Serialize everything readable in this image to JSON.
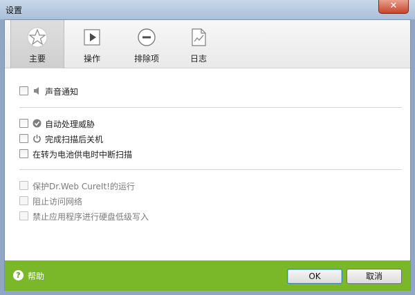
{
  "window": {
    "title": "设置",
    "close_glyph": "✕"
  },
  "toolbar": {
    "tabs": [
      {
        "label": "主要",
        "icon": "star-icon",
        "active": true
      },
      {
        "label": "操作",
        "icon": "play-icon",
        "active": false
      },
      {
        "label": "排除项",
        "icon": "minus-circle-icon",
        "active": false
      },
      {
        "label": "日志",
        "icon": "log-document-icon",
        "active": false
      }
    ]
  },
  "options": {
    "sound_notify": {
      "label": "声音通知",
      "checked": false,
      "icon": "speaker-icon"
    },
    "auto_handle": {
      "label": "自动处理威胁",
      "checked": false,
      "icon": "check-circle-icon"
    },
    "shutdown_after_scan": {
      "label": "完成扫描后关机",
      "checked": false,
      "icon": "power-icon"
    },
    "stop_on_battery": {
      "label": "在转为电池供电时中断扫描",
      "checked": false
    },
    "protect_cureit": {
      "label": "保护Dr.Web CureIt!的运行",
      "checked": false,
      "enabled": false
    },
    "block_network": {
      "label": "阻止访问网络",
      "checked": false,
      "enabled": false
    },
    "block_lowlevel_write": {
      "label": "禁止应用程序进行硬盘低级写入",
      "checked": false,
      "enabled": false
    }
  },
  "footer": {
    "help_label": "帮助",
    "help_glyph": "?",
    "ok_label": "OK",
    "cancel_label": "取消"
  },
  "colors": {
    "footer_green": "#7ab82a",
    "title_bar": "#b9cce4",
    "close_red": "#c7452c"
  }
}
